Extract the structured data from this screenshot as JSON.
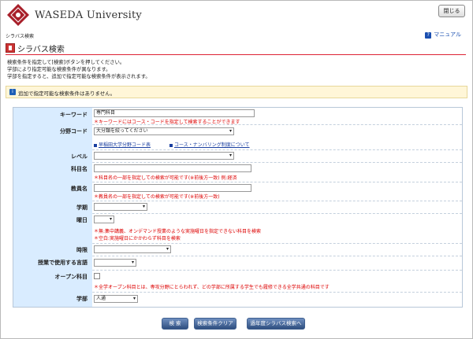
{
  "header": {
    "university": "WASEDA University",
    "close_label": "閉じる"
  },
  "breadcrumb": "シラバス検索",
  "manual": {
    "icon": "question-icon",
    "label": "マニュアル"
  },
  "page_title": "シラバス検索",
  "intro_lines": [
    "検索条件を指定して[検索]ボタンを押してください。",
    "学部により指定可能な検索条件が異なります。",
    "学部を指定すると、追加で指定可能な検索条件が表示されます。"
  ],
  "info_message": "追加で指定可能な検索条件はありません。",
  "form": {
    "keyword": {
      "label": "キーワード",
      "value": "専門科目",
      "note": "＊キーワードにはコース・コードを指定して検索することができます"
    },
    "field_code": {
      "label": "分野コード",
      "selected": "大分類を絞ってください",
      "link1": "早稲田大学分野コード表",
      "link2": "コース・ナンバリング制度について"
    },
    "level": {
      "label": "レベル",
      "selected": ""
    },
    "course_name": {
      "label": "科目名",
      "note": "＊科目名の一部を指定しての検索が可能です(※前後方一致) 例:経済"
    },
    "instructor": {
      "label": "教員名",
      "note": "＊教員名の一部を指定しての検索が可能です(※前後方一致)"
    },
    "term": {
      "label": "学期",
      "selected": ""
    },
    "day": {
      "label": "曜日",
      "selected": "",
      "note1": "＊無:集中講義、オンデマンド授業のような実施曜日を指定できない科目を検索",
      "note2": "＊空白:実施曜日にかかわらず科目を検索"
    },
    "period": {
      "label": "時限",
      "selected": ""
    },
    "language": {
      "label": "授業で使用する言語",
      "selected": ""
    },
    "open_course": {
      "label": "オープン科目",
      "note": "＊全学オープン科目とは、専攻分野にとらわれず、どの学部に所属する学生でも履修できる全学共通の科目です"
    },
    "faculty": {
      "label": "学部",
      "selected": "人通"
    }
  },
  "buttons": {
    "search": "検 索",
    "clear": "検索条件クリア",
    "previous_year": "過年度シラバス検索へ"
  }
}
